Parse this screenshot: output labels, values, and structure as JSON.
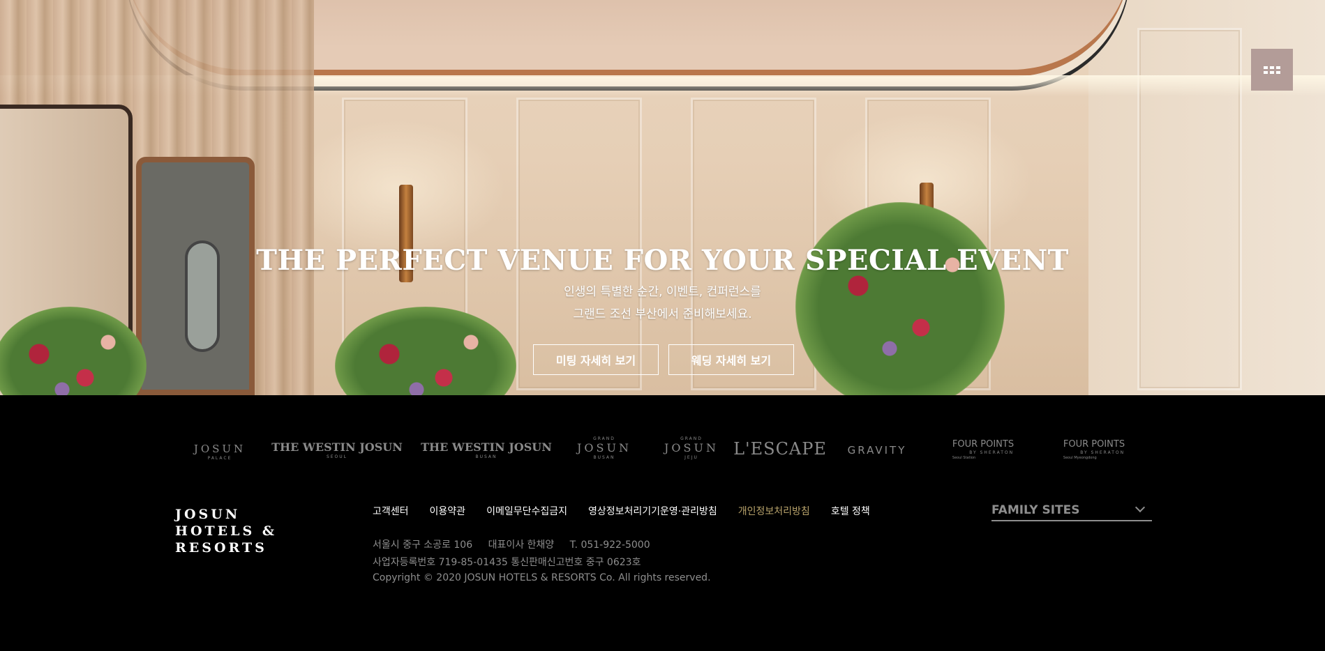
{
  "hero": {
    "title": "THE PERFECT VENUE FOR YOUR SPECIAL EVENT",
    "subtitle_line1": "인생의 특별한 순간, 이벤트, 컨퍼런스를",
    "subtitle_line2": "그랜드 조선 부산에서 준비해보세요.",
    "button_meeting": "미팅 자세히 보기",
    "button_wedding": "웨딩 자세히 보기",
    "menu_icon": "grid-menu-icon"
  },
  "brands": [
    {
      "name": "JOSUN",
      "sub": "PALACE"
    },
    {
      "name": "THE WESTIN JOSUN",
      "sub": "SEOUL"
    },
    {
      "name": "THE WESTIN JOSUN",
      "sub": "BUSAN"
    },
    {
      "top": "GRAND",
      "name": "JOSUN",
      "sub": "BUSAN"
    },
    {
      "top": "GRAND",
      "name": "JOSUN",
      "sub": "JEJU"
    },
    {
      "name": "L'ESCAPE"
    },
    {
      "name": "GRAVITY"
    },
    {
      "name": "FOUR POINTS",
      "sub": "BY SHERATON",
      "loc": "Seoul Station"
    },
    {
      "name": "FOUR POINTS",
      "sub": "BY SHERATON",
      "loc": "Seoul Myeongdong"
    }
  ],
  "footer": {
    "logo_line1": "JOSUN",
    "logo_line2": "HOTELS &",
    "logo_line3": "RESORTS",
    "nav": [
      "고객센터",
      "이용약관",
      "이메일무단수집금지",
      "영상정보처리기기운영·관리방침",
      "개인정보처리방침",
      "호텔 정책"
    ],
    "address": "서울시 중구 소공로 106",
    "ceo": "대표이사 한채양",
    "phone": "T. 051-922-5000",
    "registration": "사업자등록번호 719-85-01435 통신판매신고번호 중구 0623호",
    "copyright": "Copyright © 2020 JOSUN HOTELS & RESORTS Co. All rights reserved.",
    "family_sites": "FAMILY SITES"
  },
  "colors": {
    "footer_bg": "#000000",
    "menu_button": "#b39c98",
    "nav_highlight": "#b8a36b",
    "muted_text": "#8e8e8e"
  }
}
